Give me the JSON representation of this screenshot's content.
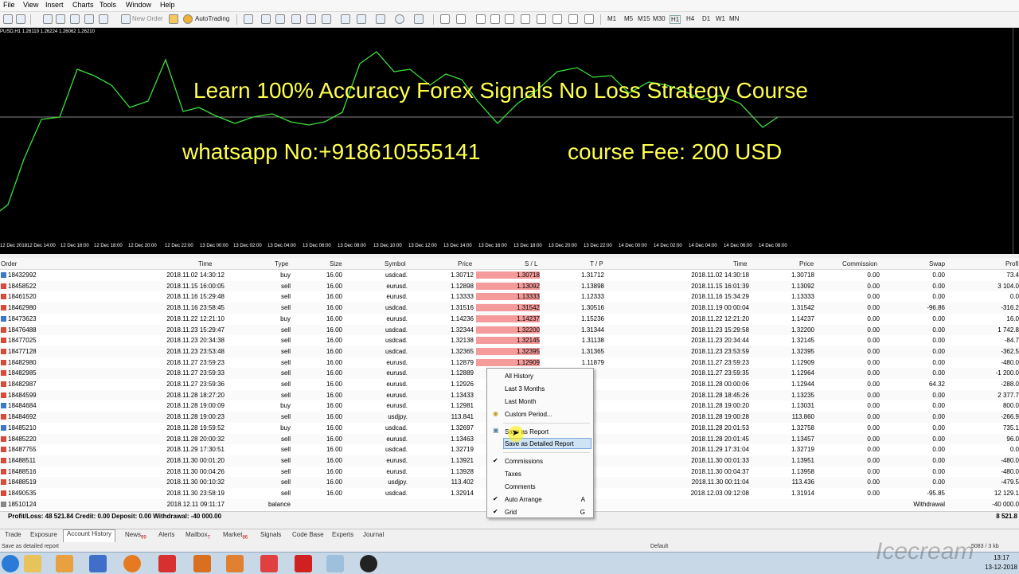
{
  "menu": [
    "File",
    "View",
    "Insert",
    "Charts",
    "Tools",
    "Window",
    "Help"
  ],
  "toolbar": {
    "new_order": "New Order",
    "autotrading": "AutoTrading",
    "timeframes": [
      "M1",
      "M5",
      "M15",
      "M30",
      "H1",
      "H4",
      "D1",
      "W1",
      "MN"
    ]
  },
  "chart": {
    "info": "PUSD,H1  1.26119 1.26224 1.26062 1.26210",
    "overlay_line1": "Learn 100% Accuracy Forex Signals  No Loss Strategy Course",
    "overlay_line2a": "whatsapp No:+918610555141",
    "overlay_line2b": "course Fee: 200 USD",
    "xlabels": [
      "12 Dec 2018",
      "12 Dec 14:00",
      "12 Dec 16:00",
      "12 Dec 18:00",
      "12 Dec 20:00",
      "12 Dec 22:00",
      "13 Dec 00:00",
      "13 Dec 02:00",
      "13 Dec 04:00",
      "13 Dec 06:00",
      "13 Dec 08:00",
      "13 Dec 10:00",
      "13 Dec 12:00",
      "13 Dec 14:00",
      "13 Dec 16:00",
      "13 Dec 18:00",
      "13 Dec 20:00",
      "13 Dec 22:00",
      "14 Dec 00:00",
      "14 Dec 02:00",
      "14 Dec 04:00",
      "14 Dec 06:00",
      "14 Dec 08:00"
    ]
  },
  "columns": [
    "Order",
    "Time",
    "Type",
    "Size",
    "Symbol",
    "Price",
    "S / L",
    "T / P",
    "Time",
    "Price",
    "Commission",
    "Swap",
    "Profit"
  ],
  "rows": [
    [
      "18432992",
      "2018.11.02 14:30:12",
      "buy",
      "16.00",
      "usdcad.",
      "1.30712",
      "1.30718",
      "1.31712",
      "2018.11.02 14:30:18",
      "1.30718",
      "0.00",
      "0.00",
      "73.4"
    ],
    [
      "18458522",
      "2018.11.15 16:00:05",
      "sell",
      "16.00",
      "eurusd.",
      "1.12898",
      "1.13092",
      "1.13898",
      "2018.11.15 16:01:39",
      "1.13092",
      "0.00",
      "0.00",
      "3 104.0"
    ],
    [
      "18461520",
      "2018.11.16 15:29:48",
      "sell",
      "16.00",
      "eurusd.",
      "1.13333",
      "1.13333",
      "1.12333",
      "2018.11.16 15:34:29",
      "1.13333",
      "0.00",
      "0.00",
      "0.0"
    ],
    [
      "18462980",
      "2018.11.16 23:58:45",
      "sell",
      "16.00",
      "usdcad.",
      "1.31516",
      "1.31542",
      "1.30516",
      "2018.11.19 00:00:04",
      "1.31542",
      "0.00",
      "-96.86",
      "-316.2"
    ],
    [
      "18473623",
      "2018.11.22 12:21:10",
      "buy",
      "16.00",
      "eurusd.",
      "1.14236",
      "1.14237",
      "1.15236",
      "2018.11.22 12:21:20",
      "1.14237",
      "0.00",
      "0.00",
      "16.0"
    ],
    [
      "18476488",
      "2018.11.23 15:29:47",
      "sell",
      "16.00",
      "usdcad.",
      "1.32344",
      "1.32200",
      "1.31344",
      "2018.11.23 15:29:58",
      "1.32200",
      "0.00",
      "0.00",
      "1 742.8"
    ],
    [
      "18477025",
      "2018.11.23 20:34:38",
      "sell",
      "16.00",
      "usdcad.",
      "1.32138",
      "1.32145",
      "1.31138",
      "2018.11.23 20:34:44",
      "1.32145",
      "0.00",
      "0.00",
      "-84.7"
    ],
    [
      "18477128",
      "2018.11.23 23:53:48",
      "sell",
      "16.00",
      "usdcad.",
      "1.32365",
      "1.32395",
      "1.31365",
      "2018.11.23 23:53:59",
      "1.32395",
      "0.00",
      "0.00",
      "-362.5"
    ],
    [
      "18482980",
      "2018.11.27 23:59:23",
      "sell",
      "16.00",
      "eurusd.",
      "1.12879",
      "1.12909",
      "1.11879",
      "2018.11.27 23:59:23",
      "1.12909",
      "0.00",
      "0.00",
      "-480.0"
    ],
    [
      "18482985",
      "2018.11.27 23:59:33",
      "sell",
      "16.00",
      "eurusd.",
      "1.12889",
      "",
      "",
      "2018.11.27 23:59:35",
      "1.12964",
      "0.00",
      "0.00",
      "-1 200.0"
    ],
    [
      "18482987",
      "2018.11.27 23:59:36",
      "sell",
      "16.00",
      "eurusd.",
      "1.12926",
      "",
      "",
      "2018.11.28 00:00:06",
      "1.12944",
      "0.00",
      "64.32",
      "-288.0"
    ],
    [
      "18484599",
      "2018.11.28 18:27:20",
      "sell",
      "16.00",
      "eurusd.",
      "1.13433",
      "",
      "",
      "2018.11.28 18:45:26",
      "1.13235",
      "0.00",
      "0.00",
      "2 377.7"
    ],
    [
      "18484684",
      "2018.11.28 19:00:09",
      "buy",
      "16.00",
      "eurusd.",
      "1.12981",
      "",
      "",
      "2018.11.28 19:00:20",
      "1.13031",
      "0.00",
      "0.00",
      "800.0"
    ],
    [
      "18484692",
      "2018.11.28 19:00:23",
      "sell",
      "16.00",
      "usdjpy.",
      "113.841",
      "",
      "",
      "2018.11.28 19:00:28",
      "113.860",
      "0.00",
      "0.00",
      "-266.9"
    ],
    [
      "18485210",
      "2018.11.28 19:59:52",
      "buy",
      "16.00",
      "usdcad.",
      "1.32697",
      "",
      "",
      "2018.11.28 20:01:53",
      "1.32758",
      "0.00",
      "0.00",
      "735.1"
    ],
    [
      "18485220",
      "2018.11.28 20:00:32",
      "sell",
      "16.00",
      "eurusd.",
      "1.13463",
      "",
      "",
      "2018.11.28 20:01:45",
      "1.13457",
      "0.00",
      "0.00",
      "96.0"
    ],
    [
      "18487755",
      "2018.11.29 17:30:51",
      "sell",
      "16.00",
      "usdcad.",
      "1.32719",
      "",
      "",
      "2018.11.29 17:31:04",
      "1.32719",
      "0.00",
      "0.00",
      "0.0"
    ],
    [
      "18488511",
      "2018.11.30 00:01:20",
      "sell",
      "16.00",
      "eurusd.",
      "1.13921",
      "",
      "",
      "2018.11.30 00:01:33",
      "1.13951",
      "0.00",
      "0.00",
      "-480.0"
    ],
    [
      "18488516",
      "2018.11.30 00:04:26",
      "sell",
      "16.00",
      "eurusd.",
      "1.13928",
      "",
      "",
      "2018.11.30 00:04:37",
      "1.13958",
      "0.00",
      "0.00",
      "-480.0"
    ],
    [
      "18488519",
      "2018.11.30 00:10:32",
      "sell",
      "16.00",
      "usdjpy.",
      "113.402",
      "",
      "",
      "2018.11.30 00:11:04",
      "113.436",
      "0.00",
      "0.00",
      "-479.5"
    ],
    [
      "18490535",
      "2018.11.30 23:58:19",
      "sell",
      "16.00",
      "usdcad.",
      "1.32914",
      "",
      "",
      "2018.12.03 09:12:08",
      "1.31914",
      "0.00",
      "-95.85",
      "12 129.1"
    ],
    [
      "18510124",
      "2018.12.11 09:11:17",
      "balance",
      "",
      "",
      "",
      "",
      "",
      "",
      "",
      "",
      "Withdrawal",
      "-40 000.0"
    ]
  ],
  "footer": {
    "summary": "Profit/Loss: 48 521.84  Credit: 0.00  Deposit: 0.00  Withdrawal: -40 000.00",
    "total": "8 521.8"
  },
  "context_menu": {
    "items": [
      "All History",
      "Last 3 Months",
      "Last Month",
      "Custom Period...",
      "Save as Report",
      "Save as Detailed Report",
      "Commissions",
      "Taxes",
      "Comments",
      "Auto Arrange",
      "Grid"
    ],
    "shortcuts": {
      "auto_arrange": "A",
      "grid": "G"
    }
  },
  "tabs": [
    "Trade",
    "Exposure",
    "Account History",
    "News",
    "Alerts",
    "Mailbox",
    "Market",
    "Signals",
    "Code Base",
    "Experts",
    "Journal"
  ],
  "tab_badges": {
    "news": "99",
    "mailbox": "7",
    "market": "86"
  },
  "status": {
    "left": "Save as detailed report",
    "middle": "Default",
    "right": "5083 / 3 kb"
  },
  "taskbar": {
    "time": "13:17",
    "date": "13-12-2018"
  },
  "watermark": "Icecream"
}
